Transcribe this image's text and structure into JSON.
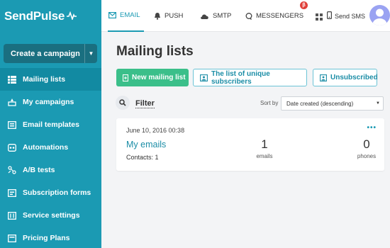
{
  "brand": {
    "name": "SendPulse"
  },
  "sidebar": {
    "create_label": "Create a campaign",
    "items": [
      {
        "label": "Mailing lists",
        "icon": "list-icon"
      },
      {
        "label": "My campaigns",
        "icon": "campaigns-icon"
      },
      {
        "label": "Email templates",
        "icon": "template-icon"
      },
      {
        "label": "Automations",
        "icon": "automation-icon"
      },
      {
        "label": "A/B tests",
        "icon": "ab-test-icon"
      },
      {
        "label": "Subscription forms",
        "icon": "form-icon"
      },
      {
        "label": "Service settings",
        "icon": "settings-icon"
      },
      {
        "label": "Pricing Plans",
        "icon": "pricing-icon"
      }
    ]
  },
  "topbar": {
    "tabs": [
      {
        "label": "EMAIL",
        "icon": "envelope-icon"
      },
      {
        "label": "PUSH",
        "icon": "bell-icon"
      },
      {
        "label": "SMTP",
        "icon": "cloud-icon"
      },
      {
        "label": "MESSENGERS",
        "icon": "chat-icon"
      }
    ],
    "messengers_badge": "β",
    "sms_label": "Send SMS"
  },
  "main": {
    "title": "Mailing lists",
    "buttons": {
      "new_list": "New mailing list",
      "unique_subscribers": "The list of unique subscribers",
      "unsubscribed": "Unsubscribed"
    },
    "filter_label": "Filter",
    "sort_label": "Sort by",
    "sort_value": "Date created (descending)"
  },
  "lists": [
    {
      "date": "June 10, 2016 00:38",
      "name": "My emails",
      "contacts": "Contacts: 1",
      "emails_count": "1",
      "emails_label": "emails",
      "phones_count": "0",
      "phones_label": "phones",
      "more": "•••"
    }
  ],
  "colors": {
    "sidebar": "#1b9ab3",
    "primary": "#3bbf8a",
    "accent": "#1b8da6"
  }
}
